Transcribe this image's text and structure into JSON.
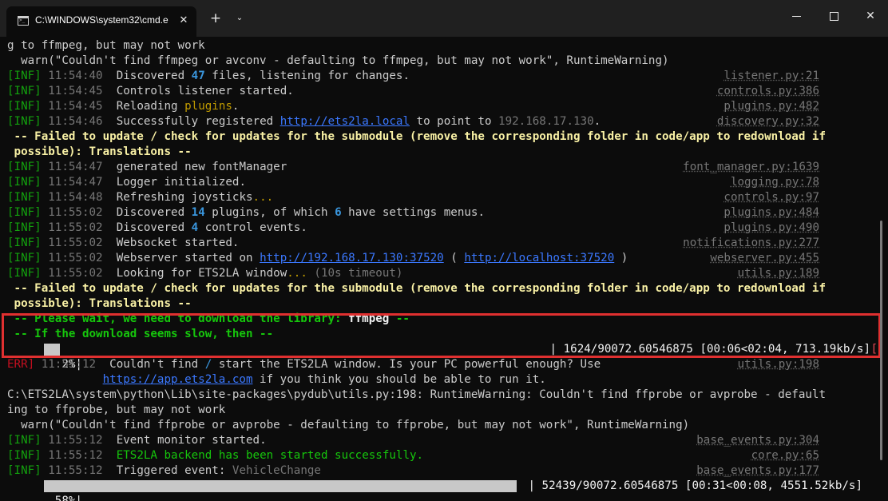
{
  "window": {
    "tab_title": "C:\\WINDOWS\\system32\\cmd.e",
    "tab_close": "✕",
    "new_tab": "+",
    "dropdown": "⌄",
    "close": "✕",
    "icons": {
      "tab": "cmd-icon",
      "minimize": "minimize-icon",
      "maximize": "maximize-icon",
      "close": "close-icon"
    }
  },
  "terminal": {
    "l0": "g to ffmpeg, but may not work",
    "l1": "  warn(\"Couldn't find ffmpeg or avconv - defaulting to ffmpeg, but may not work\", RuntimeWarning)",
    "l2": {
      "tag": "[INF]",
      "time": "11:54:40",
      "a": "Discovered ",
      "n": "47",
      "b": " files, listening for changes.",
      "src": "listener.py:21"
    },
    "l3": {
      "tag": "[INF]",
      "time": "11:54:45",
      "text": "Controls listener started.",
      "src": "controls.py:386"
    },
    "l4": {
      "tag": "[INF]",
      "time": "11:54:45",
      "a": "Reloading ",
      "hl": "plugins",
      "b": ".",
      "src": "plugins.py:482"
    },
    "l5": {
      "tag": "[INF]",
      "time": "11:54:46",
      "a": "Successfully registered ",
      "link": "http://ets2la.local",
      "b": " to point to ",
      "ip": "192.168.17.130",
      "c": ".",
      "src": "discovery.py:32"
    },
    "l6": " -- Failed to update / check for updates for the submodule (remove the corresponding folder in code/app to redownload if",
    "l7": " possible): Translations --",
    "l8": {
      "tag": "[INF]",
      "time": "11:54:47",
      "text": "generated new fontManager",
      "src": "font_manager.py:1639"
    },
    "l9": {
      "tag": "[INF]",
      "time": "11:54:47",
      "text": "Logger initialized.",
      "src": "logging.py:78"
    },
    "l10": {
      "tag": "[INF]",
      "time": "11:54:48",
      "a": "Refreshing joysticks",
      "hl": "...",
      "src": "controls.py:97"
    },
    "l11": {
      "tag": "[INF]",
      "time": "11:55:02",
      "a": "Discovered ",
      "n1": "14",
      "b": " plugins, of which ",
      "n2": "6",
      "c": " have settings menus.",
      "src": "plugins.py:484"
    },
    "l12": {
      "tag": "[INF]",
      "time": "11:55:02",
      "a": "Discovered ",
      "n": "4",
      "b": " control events.",
      "src": "plugins.py:490"
    },
    "l13": {
      "tag": "[INF]",
      "time": "11:55:02",
      "text": "Websocket started.",
      "src": "notifications.py:277"
    },
    "l14": {
      "tag": "[INF]",
      "time": "11:55:02",
      "a": "Webserver started on ",
      "link1": "http://192.168.17.130:37520",
      "b": " ( ",
      "link2": "http://localhost:37520",
      "c": " )",
      "src": "webserver.py:455"
    },
    "l15": {
      "tag": "[INF]",
      "time": "11:55:02",
      "a": "Looking for ETS2LA window",
      "hl": "...",
      "b": " (10s timeout)",
      "src": "utils.py:189"
    },
    "l16": " -- Failed to update / check for updates for the submodule (remove the corresponding folder in code/app to redownload if",
    "l17": " possible): Translations --",
    "l18": {
      "a": " -- Please wait, we need to download the library: ",
      "lib": "ffmpeg",
      "b": " --"
    },
    "l19": " -- If the download seems slow, then --",
    "l20": {
      "pct": "  2%|",
      "progress": 0.02,
      "stats": "| 1624/90072.60546875 [00:06<02:04, 713.19kb/s]",
      "tail": "["
    },
    "l21": {
      "tag": "ERR]",
      "time": "11:55:12",
      "a": "Couldn't find ",
      "slash": "/",
      "b": " start the ETS2LA window. Is your PC powerful enough? Use",
      "src": "utils.py:198"
    },
    "l22": {
      "indent": "              ",
      "link": "https://app.ets2la.com",
      "b": " if you think you should be able to run it."
    },
    "l23": "C:\\ETS2LA\\system\\python\\Lib\\site-packages\\pydub\\utils.py:198: RuntimeWarning: Couldn't find ffprobe or avprobe - default",
    "l24": "ing to ffprobe, but may not work",
    "l25": "  warn(\"Couldn't find ffprobe or avprobe - defaulting to ffprobe, but may not work\", RuntimeWarning)",
    "l26": {
      "tag": "[INF]",
      "time": "11:55:12",
      "text": "Event monitor started.",
      "src": "base_events.py:304"
    },
    "l27": {
      "tag": "[INF]",
      "time": "11:55:12",
      "text": "ETS2LA backend has been started successfully.",
      "src": "core.py:65"
    },
    "l28": {
      "tag": "[INF]",
      "time": "11:55:12",
      "a": "Triggered event: ",
      "event": "VehicleChange",
      "src": "base_events.py:177"
    },
    "l29": {
      "pct": " 58%|",
      "progress": 0.58,
      "stats": "| 52439/90072.60546875 [00:31<00:08, 4551.52kb/s]"
    }
  }
}
